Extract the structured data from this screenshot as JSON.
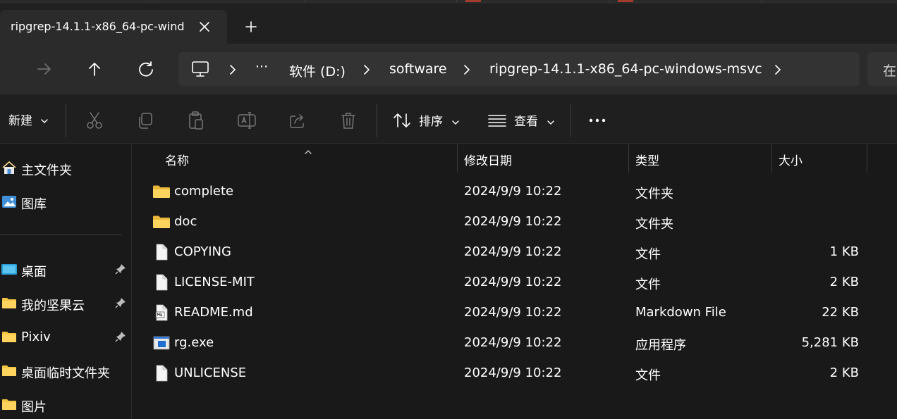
{
  "tab": {
    "title": "ripgrep-14.1.1-x86_64-pc-wind",
    "close_icon": "close-icon",
    "new_tab_icon": "plus-icon"
  },
  "navigation": {
    "back_icon": "arrow-left-icon",
    "forward_icon": "arrow-right-icon",
    "up_icon": "arrow-up-icon",
    "refresh_icon": "refresh-icon"
  },
  "address": {
    "computer_icon": "monitor-icon",
    "overflow": "···",
    "crumbs": [
      "软件 (D:)",
      "software",
      "ripgrep-14.1.1-x86_64-pc-windows-msvc"
    ],
    "search_partial": "在"
  },
  "commands": {
    "new_label": "新建",
    "sort_label": "排序",
    "view_label": "查看",
    "more_icon": "more-dots-icon",
    "icons": [
      "cut-icon",
      "copy-icon",
      "paste-icon",
      "rename-icon",
      "share-icon",
      "delete-icon"
    ]
  },
  "sidebar": {
    "top_items": [
      {
        "label": "主文件夹",
        "icon": "home-icon"
      },
      {
        "label": "图库",
        "icon": "gallery-icon"
      }
    ],
    "quick_items": [
      {
        "label": "桌面",
        "icon": "desktop-icon",
        "pinned": true
      },
      {
        "label": "我的坚果云",
        "icon": "folder-icon",
        "pinned": true
      },
      {
        "label": "Pixiv",
        "icon": "folder-icon",
        "pinned": true
      },
      {
        "label": "桌面临时文件夹",
        "icon": "folder-icon",
        "pinned": false
      },
      {
        "label": "图片",
        "icon": "folder-icon",
        "pinned": false
      }
    ]
  },
  "columns": {
    "name": "名称",
    "date": "修改日期",
    "type": "类型",
    "size": "大小"
  },
  "files": [
    {
      "name": "complete",
      "date": "2024/9/9 10:22",
      "type": "文件夹",
      "size": "",
      "icon": "folder-icon"
    },
    {
      "name": "doc",
      "date": "2024/9/9 10:22",
      "type": "文件夹",
      "size": "",
      "icon": "folder-icon"
    },
    {
      "name": "COPYING",
      "date": "2024/9/9 10:22",
      "type": "文件",
      "size": "1 KB",
      "icon": "file-icon"
    },
    {
      "name": "LICENSE-MIT",
      "date": "2024/9/9 10:22",
      "type": "文件",
      "size": "2 KB",
      "icon": "file-icon"
    },
    {
      "name": "README.md",
      "date": "2024/9/9 10:22",
      "type": "Markdown File",
      "size": "22 KB",
      "icon": "markdown-file-icon"
    },
    {
      "name": "rg.exe",
      "date": "2024/9/9 10:22",
      "type": "应用程序",
      "size": "5,281 KB",
      "icon": "exe-icon"
    },
    {
      "name": "UNLICENSE",
      "date": "2024/9/9 10:22",
      "type": "文件",
      "size": "2 KB",
      "icon": "file-icon"
    }
  ],
  "colors": {
    "folder": "#f4c542",
    "accent": "#4cc2ff"
  }
}
